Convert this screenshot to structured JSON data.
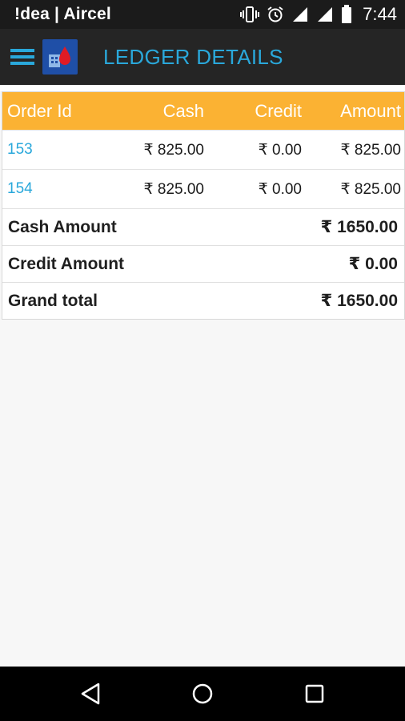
{
  "status_bar": {
    "carrier": "!dea | Aircel",
    "time": "7:44",
    "icons": [
      "vibrate-icon",
      "alarm-icon",
      "signal-icon",
      "signal-icon",
      "battery-icon"
    ]
  },
  "app_bar": {
    "title": "LEDGER DETAILS",
    "icons": [
      "menu-icon",
      "app-logo-icon"
    ]
  },
  "table": {
    "headers": {
      "order_id": "Order Id",
      "cash": "Cash",
      "credit": "Credit",
      "amount": "Amount"
    },
    "rows": [
      {
        "order_id": "153",
        "cash": "₹ 825.00",
        "credit": "₹ 0.00",
        "amount": "₹ 825.00"
      },
      {
        "order_id": "154",
        "cash": "₹ 825.00",
        "credit": "₹ 0.00",
        "amount": "₹ 825.00"
      }
    ],
    "summary": {
      "cash_label": "Cash Amount",
      "cash_value": "₹ 1650.00",
      "credit_label": "Credit Amount",
      "credit_value": "₹ 0.00",
      "grand_label": "Grand total",
      "grand_value": "₹ 1650.00"
    }
  },
  "colors": {
    "header_bg": "#fbb233",
    "accent_blue": "#2aa8db",
    "app_bar_bg": "#252525"
  },
  "nav_bar": {
    "icons": [
      "back-icon",
      "home-icon",
      "recents-icon"
    ]
  }
}
